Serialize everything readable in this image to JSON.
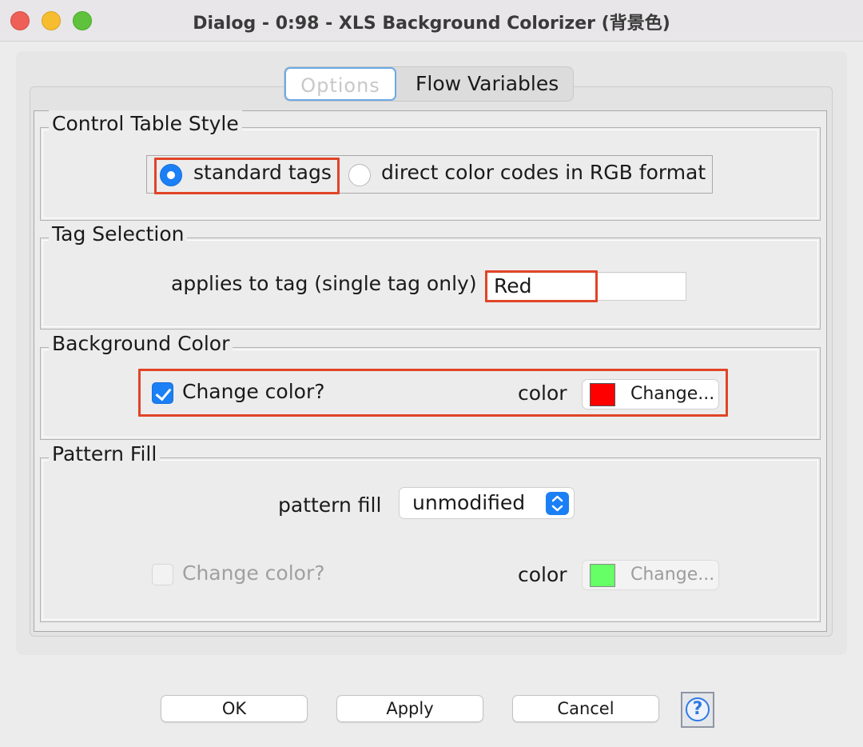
{
  "window": {
    "title": "Dialog - 0:98 - XLS Background Colorizer (背景色)"
  },
  "tabs": [
    {
      "label": "Options",
      "selected": true
    },
    {
      "label": "Flow Variables",
      "selected": false
    }
  ],
  "control_table_style": {
    "title": "Control Table Style",
    "options": [
      {
        "label": "standard tags",
        "selected": true
      },
      {
        "label": "direct color codes in RGB format",
        "selected": false
      }
    ]
  },
  "tag_selection": {
    "title": "Tag Selection",
    "label": "applies to tag (single tag only)",
    "value": "Red"
  },
  "background_color": {
    "title": "Background Color",
    "checkbox_label": "Change color?",
    "checked": true,
    "color_label": "color",
    "color_value": "#ff0000",
    "button_label": "Change..."
  },
  "pattern_fill": {
    "title": "Pattern Fill",
    "label": "pattern fill",
    "selected": "unmodified",
    "checkbox_label": "Change color?",
    "checked": false,
    "enabled": false,
    "color_label": "color",
    "color_value": "#66ff66",
    "button_label": "Change..."
  },
  "footer": {
    "ok_label": "OK",
    "apply_label": "Apply",
    "cancel_label": "Cancel",
    "help_symbol": "?"
  },
  "colors": {
    "accent": "#1b7ff5",
    "highlight": "#e04427"
  }
}
